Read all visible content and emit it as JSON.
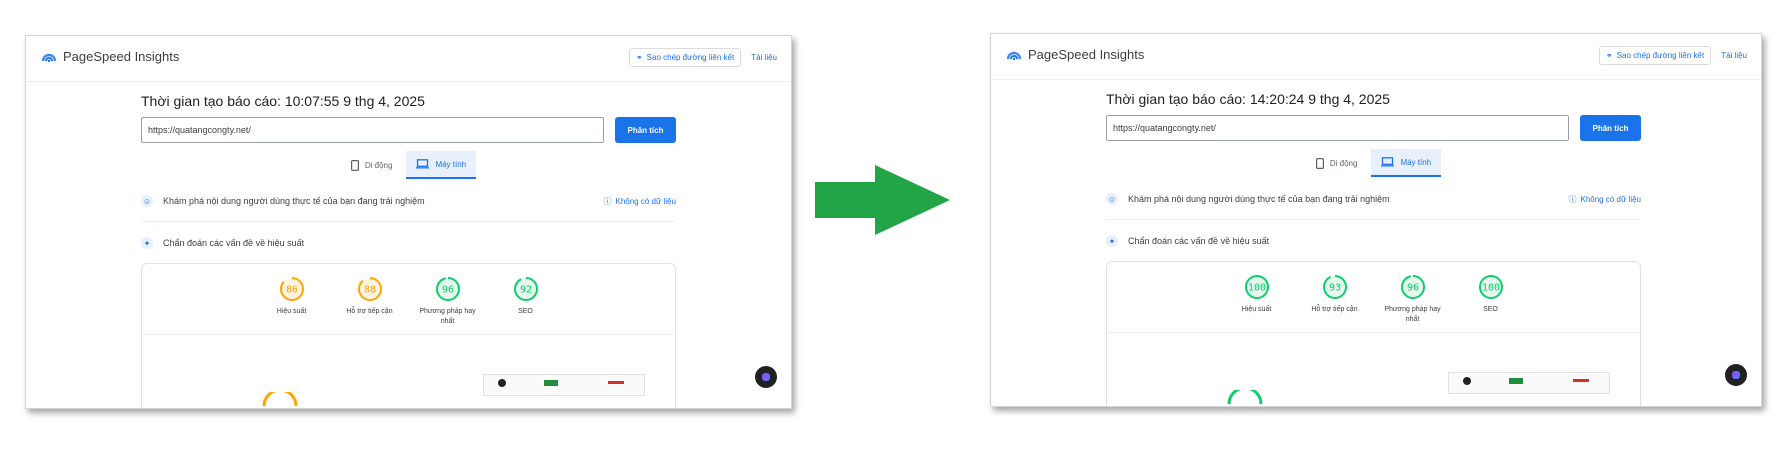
{
  "colors": {
    "fast": "#0cce6b",
    "average": "#ffa400",
    "brand": "#1a73e8",
    "arrow": "#22a547"
  },
  "panels": [
    {
      "header": {
        "brand": "PageSpeed Insights",
        "copy_link": "Sao chép đường liên kết",
        "docs": "Tài liệu"
      },
      "report_time": "Thời gian tạo báo cáo: 10:07:55 9 thg 4, 2025",
      "url": "https://quatangcongty.net/",
      "analyze": "Phân tích",
      "tabs": [
        {
          "label": "Di động",
          "icon": "mobile-icon",
          "active": false
        },
        {
          "label": "Máy tính",
          "icon": "desktop-icon",
          "active": true
        }
      ],
      "field_data": {
        "text": "Khám phá nội dung người dùng thực tế của bạn đang trải nghiệm",
        "status": "Không có dữ liệu"
      },
      "diagnose": "Chẩn đoán các vấn đề về hiệu suất",
      "scores": [
        {
          "label": "Hiệu suất",
          "value": 86
        },
        {
          "label": "Hỗ trợ tiếp cận",
          "value": 88
        },
        {
          "label": "Phương pháp hay nhất",
          "value": 96
        },
        {
          "label": "SEO",
          "value": 92
        }
      ]
    },
    {
      "header": {
        "brand": "PageSpeed Insights",
        "copy_link": "Sao chép đường liên kết",
        "docs": "Tài liệu"
      },
      "report_time": "Thời gian tạo báo cáo: 14:20:24 9 thg 4, 2025",
      "url": "https://quatangcongty.net/",
      "analyze": "Phân tích",
      "tabs": [
        {
          "label": "Di động",
          "icon": "mobile-icon",
          "active": false
        },
        {
          "label": "Máy tính",
          "icon": "desktop-icon",
          "active": true
        }
      ],
      "field_data": {
        "text": "Khám phá nội dung người dùng thực tế của bạn đang trải nghiệm",
        "status": "Không có dữ liệu"
      },
      "diagnose": "Chẩn đoán các vấn đề về hiệu suất",
      "scores": [
        {
          "label": "Hiệu suất",
          "value": 100
        },
        {
          "label": "Hỗ trợ tiếp cận",
          "value": 93
        },
        {
          "label": "Phương pháp hay nhất",
          "value": 96
        },
        {
          "label": "SEO",
          "value": 100
        }
      ]
    }
  ]
}
